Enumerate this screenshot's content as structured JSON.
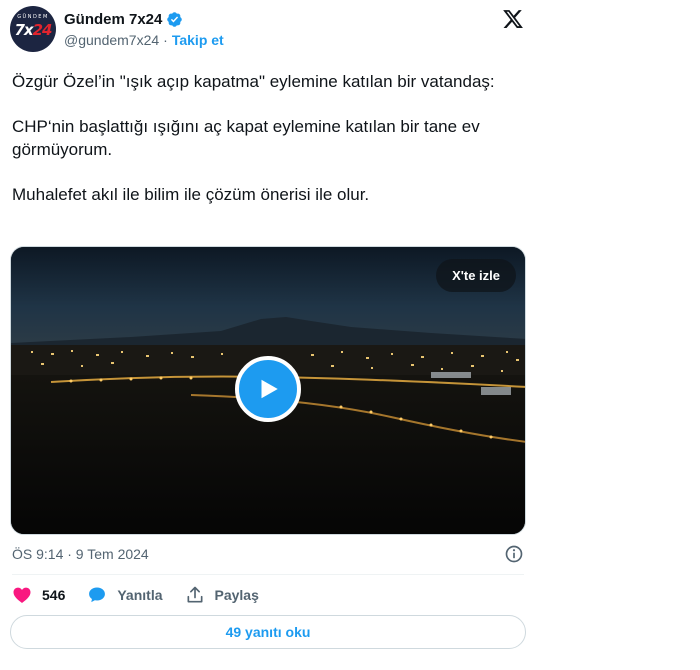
{
  "author": {
    "display_name": "Gündem 7x24",
    "handle": "@gundem7x24",
    "separator": "·",
    "follow_label": "Takip et",
    "avatar": {
      "small_text": "GÜNDEM",
      "big_text_a": "7x",
      "big_text_b": "24"
    }
  },
  "tweet": {
    "paragraphs": [
      "Özgür Özel’in \"ışık açıp kapatma\" eylemine katılan bir vatandaş:",
      "CHP‘nin başlattığı ışığını aç kapat eylemine katılan bir tane ev görmüyorum.",
      "Muhalefet akıl ile bilim ile çözüm önerisi ile olur."
    ]
  },
  "video": {
    "watch_label": "X'te izle"
  },
  "meta": {
    "timestamp": "ÖS 9:14 · 9 Tem 2024"
  },
  "actions": {
    "like_count": "546",
    "reply_label": "Yanıtla",
    "share_label": "Paylaş"
  },
  "replies_button": {
    "label": "49 yanıtı oku"
  },
  "colors": {
    "accent": "#1d9bf0",
    "like": "#f91880",
    "muted": "#536471",
    "text": "#0f1419"
  }
}
